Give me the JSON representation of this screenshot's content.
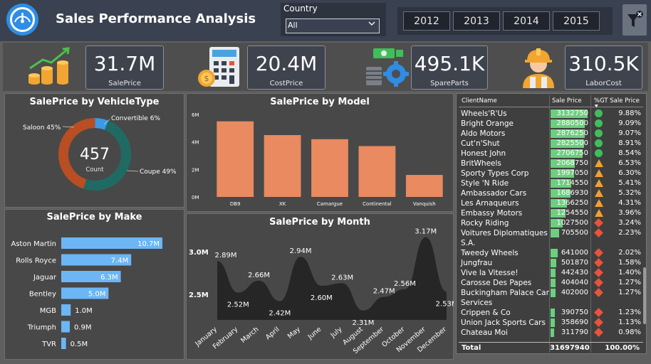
{
  "header": {
    "title": "Sales Performance Analysis",
    "country_label": "Country",
    "country_value": "All",
    "years": [
      "2012",
      "2013",
      "2014",
      "2015"
    ]
  },
  "kpis": [
    {
      "value": "31.7M",
      "label": "SalePrice"
    },
    {
      "value": "20.4M",
      "label": "CostPrice"
    },
    {
      "value": "495.1K",
      "label": "SpareParts"
    },
    {
      "value": "310.5K",
      "label": "LaborCost"
    }
  ],
  "colors": {
    "accent_blue": "#2f8de4",
    "bar_salmon": "#e98a60",
    "bar_blue": "#6cb6f5",
    "donut_orange": "#b84e22",
    "donut_teal": "#1f6b63",
    "donut_blue": "#3a9ae8",
    "table_bar_green": "#6ccf7f"
  },
  "chart_data": [
    {
      "type": "pie",
      "title": "SalePrice by VehicleType",
      "center_value": "457",
      "center_label": "Count",
      "slices": [
        {
          "name": "Convertible",
          "value": 6,
          "label": "Convertible 6%"
        },
        {
          "name": "Coupe",
          "value": 49,
          "label": "Coupe 49%"
        },
        {
          "name": "Saloon",
          "value": 45,
          "label": "Saloon 45%"
        }
      ]
    },
    {
      "type": "bar",
      "title": "SalePrice by Model",
      "categories": [
        "DB9",
        "XK",
        "Camargue",
        "Continental",
        "Vanquish"
      ],
      "values": [
        5.5,
        4.5,
        4.2,
        3.7,
        1.6
      ],
      "yticks": [
        "6M",
        "4M",
        "2M",
        "0M"
      ],
      "ylim": [
        0,
        6
      ]
    },
    {
      "type": "bar",
      "title": "SalePrice by Make",
      "orientation": "horizontal",
      "categories": [
        "Aston Martin",
        "Rolls Royce",
        "Jaguar",
        "Bentley",
        "MGB",
        "Triumph",
        "TVR"
      ],
      "values": [
        10.7,
        7.4,
        6.3,
        5.0,
        1.0,
        0.9,
        0.5
      ],
      "labels": [
        "10.7M",
        "7.4M",
        "6.3M",
        "5.0M",
        "1.0M",
        "0.9M",
        "0.5M"
      ]
    },
    {
      "type": "area",
      "title": "SalePrice by Month",
      "categories": [
        "January",
        "February",
        "March",
        "April",
        "May",
        "June",
        "July",
        "August",
        "September",
        "October",
        "November",
        "December"
      ],
      "values": [
        2.89,
        2.52,
        2.66,
        2.42,
        2.94,
        2.6,
        2.63,
        2.31,
        2.47,
        2.56,
        3.17,
        2.53
      ],
      "labels": [
        "2.89M",
        "2.52M",
        "2.66M",
        "2.42M",
        "2.94M",
        "2.60M",
        "2.63M",
        "2.31M",
        "2.47M",
        "2.56M",
        "3.17M",
        "2.53M"
      ],
      "yticks": [
        "3.0M",
        "2.5M"
      ]
    }
  ],
  "table": {
    "headers": [
      "ClientName",
      "Sale Price",
      "%GT Sale Price"
    ],
    "rows": [
      {
        "name": "Wheels'R'Us",
        "value": "3132750",
        "pct": "9.88%",
        "status": "green",
        "frac": 1.0
      },
      {
        "name": "Bright Orange",
        "value": "2880500",
        "pct": "9.09%",
        "status": "green",
        "frac": 0.92
      },
      {
        "name": "Aldo Motors",
        "value": "2876250",
        "pct": "9.07%",
        "status": "green",
        "frac": 0.92
      },
      {
        "name": "Cut'n'Shut",
        "value": "2825500",
        "pct": "8.91%",
        "status": "green",
        "frac": 0.9
      },
      {
        "name": "Honest John",
        "value": "2706750",
        "pct": "8.54%",
        "status": "green",
        "frac": 0.86
      },
      {
        "name": "BritWheels",
        "value": "2068750",
        "pct": "6.53%",
        "status": "warn",
        "frac": 0.66
      },
      {
        "name": "Sporty Types Corp",
        "value": "1997050",
        "pct": "6.30%",
        "status": "warn",
        "frac": 0.64
      },
      {
        "name": "Style 'N Ride",
        "value": "1714550",
        "pct": "5.41%",
        "status": "warn",
        "frac": 0.55
      },
      {
        "name": "Ambassador Cars",
        "value": "1686930",
        "pct": "5.32%",
        "status": "warn",
        "frac": 0.54
      },
      {
        "name": "Les Arnaqueurs",
        "value": "1366250",
        "pct": "4.31%",
        "status": "warn",
        "frac": 0.44
      },
      {
        "name": "Embassy Motors",
        "value": "1254550",
        "pct": "3.96%",
        "status": "warn",
        "frac": 0.4
      },
      {
        "name": "Rocky Riding",
        "value": "1027500",
        "pct": "3.24%",
        "status": "red",
        "frac": 0.33
      },
      {
        "name": "Voitures Diplomatiques S.A.",
        "value": "705500",
        "pct": "2.23%",
        "status": "red",
        "frac": 0.23
      },
      {
        "name": "Tweedy Wheels",
        "value": "641000",
        "pct": "2.02%",
        "status": "red",
        "frac": 0.2
      },
      {
        "name": "Jungfrau",
        "value": "501870",
        "pct": "1.58%",
        "status": "red",
        "frac": 0.16
      },
      {
        "name": "Vive la Vitesse!",
        "value": "442430",
        "pct": "1.40%",
        "status": "red",
        "frac": 0.14
      },
      {
        "name": "Carosse Des Papes",
        "value": "404040",
        "pct": "1.27%",
        "status": "red",
        "frac": 0.13
      },
      {
        "name": "Buckingham Palace Car Services",
        "value": "402000",
        "pct": "1.27%",
        "status": "red",
        "frac": 0.13
      },
      {
        "name": "Crippen & Co",
        "value": "390750",
        "pct": "1.23%",
        "status": "red",
        "frac": 0.12
      },
      {
        "name": "Union Jack Sports Cars",
        "value": "358690",
        "pct": "1.13%",
        "status": "red",
        "frac": 0.11
      },
      {
        "name": "Chateau Moi",
        "value": "311790",
        "pct": "0.98%",
        "status": "red",
        "frac": 0.1
      }
    ],
    "total_label": "Total",
    "total_value": "31697940",
    "total_pct": "100.00%"
  }
}
